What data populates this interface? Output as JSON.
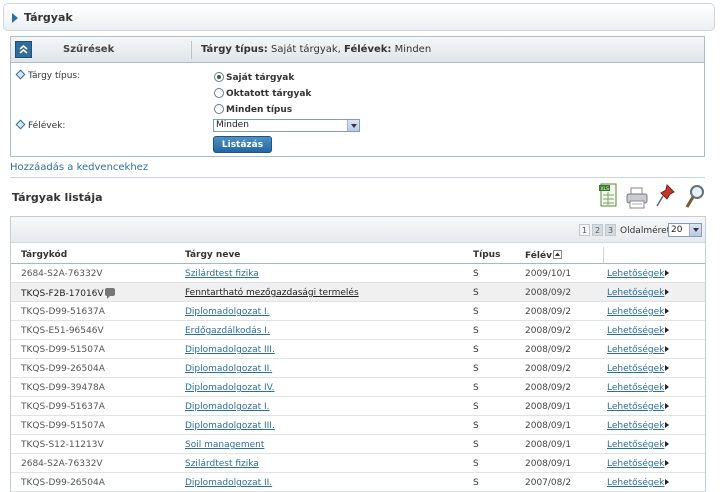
{
  "page": {
    "title": "Tárgyak"
  },
  "filter": {
    "header_label": "Szűrések",
    "summary_type_label": "Tárgy típus:",
    "summary_type_value": "Saját tárgyak,",
    "summary_semester_label": "Félévek:",
    "summary_semester_value": "Minden",
    "type_label": "Tárgy típus:",
    "semester_label": "Félévek:",
    "radio_options": [
      "Saját tárgyak",
      "Oktatott tárgyak",
      "Minden típus"
    ],
    "semester_selected": "Minden",
    "list_button": "Listázás"
  },
  "favorites_link": "Hozzáadás a kedvencekhez",
  "list": {
    "title": "Tárgyak listája",
    "pages": [
      "1",
      "2",
      "3"
    ],
    "page_size_label": "Oldalméret",
    "page_size": "20",
    "columns": [
      "Tárgykód",
      "Tárgy neve",
      "Típus",
      "Félév"
    ],
    "options_label": "Lehetőségek",
    "rows": [
      {
        "code": "2684-S2A-76332V",
        "name": "Szilárdtest fizika",
        "type": "S",
        "semester": "2009/10/1"
      },
      {
        "code": "TKQS-F2B-17016V",
        "name": "Fenntartható mezőgazdasági termelés",
        "type": "S",
        "semester": "2008/09/2"
      },
      {
        "code": "TKQS-D99-51637A",
        "name": "Diplomadolgozat I.",
        "type": "S",
        "semester": "2008/09/2"
      },
      {
        "code": "TKQS-E51-96546V",
        "name": "Erdőgazdálkodás I.",
        "type": "S",
        "semester": "2008/09/2"
      },
      {
        "code": "TKQS-D99-51507A",
        "name": "Diplomadolgozat III.",
        "type": "S",
        "semester": "2008/09/2"
      },
      {
        "code": "TKQS-D99-26504A",
        "name": "Diplomadolgozat II.",
        "type": "S",
        "semester": "2008/09/2"
      },
      {
        "code": "TKQS-D99-39478A",
        "name": "Diplomadolgozat IV.",
        "type": "S",
        "semester": "2008/09/2"
      },
      {
        "code": "TKQS-D99-51637A",
        "name": "Diplomadolgozat I.",
        "type": "S",
        "semester": "2008/09/1"
      },
      {
        "code": "TKQS-D99-51507A",
        "name": "Diplomadolgozat III.",
        "type": "S",
        "semester": "2008/09/1"
      },
      {
        "code": "TKQS-S12-11213V",
        "name": "Soil management",
        "type": "S",
        "semester": "2008/09/1"
      },
      {
        "code": "2684-S2A-76332V",
        "name": "Szilárdtest fizika",
        "type": "S",
        "semester": "2008/09/1"
      },
      {
        "code": "TKQS-D99-26504A",
        "name": "Diplomadolgozat II.",
        "type": "S",
        "semester": "2007/08/2"
      }
    ]
  },
  "colors": {
    "accent": "#2b6f9e",
    "button": "#2466a0"
  },
  "icons": [
    "chevron-right-icon",
    "collapse-up-icon",
    "excel-export-icon",
    "print-icon",
    "pin-icon",
    "search-icon",
    "comment-icon",
    "sort-asc-icon"
  ]
}
